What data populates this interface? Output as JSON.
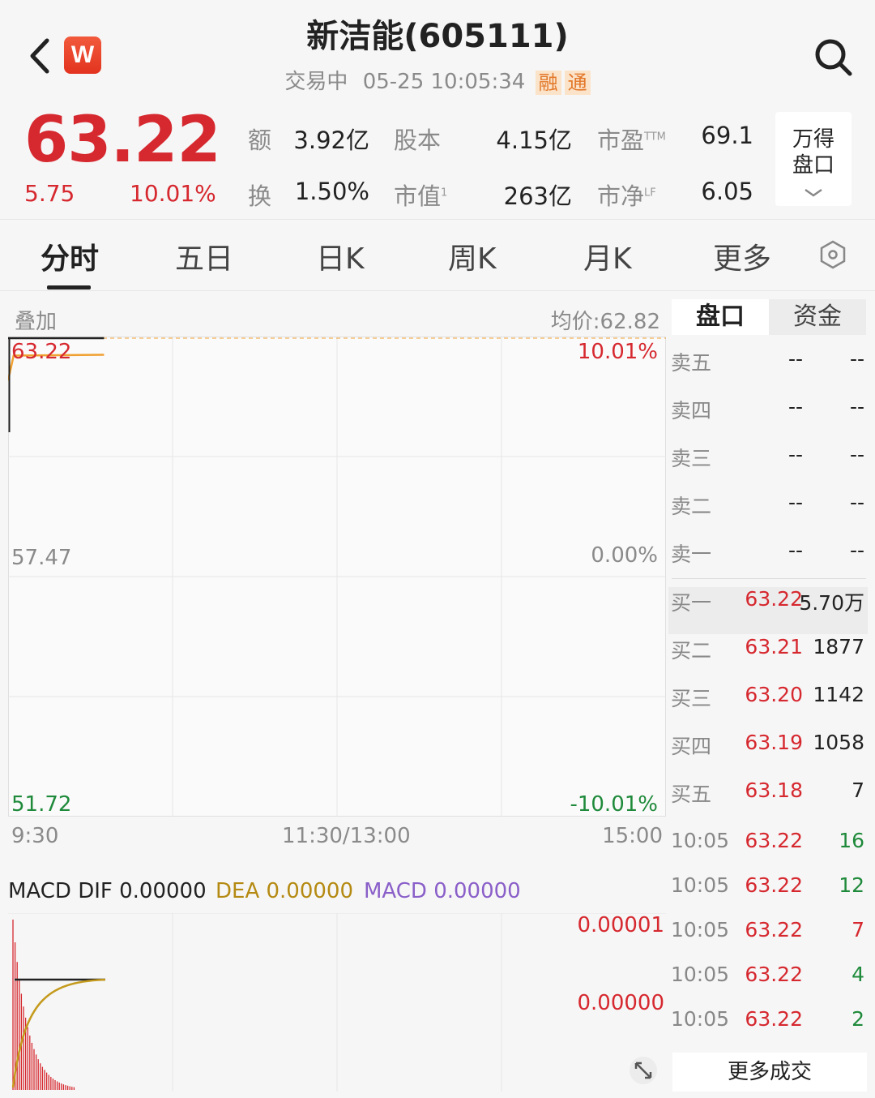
{
  "header": {
    "title": "新洁能(605111)",
    "status": "交易中",
    "datetime": "05-25 10:05:34",
    "tag_margin": "融",
    "tag_connect": "通",
    "logo_letter": "W"
  },
  "quote": {
    "price": "63.22",
    "change": "5.75",
    "change_pct": "10.01%",
    "amount_label": "额",
    "amount": "3.92亿",
    "shares_label": "股本",
    "shares": "4.15亿",
    "pe_label": "市盈",
    "pe_sup": "TTM",
    "pe": "69.1",
    "turnover_label": "换",
    "turnover": "1.50%",
    "mktcap_label": "市值",
    "mktcap_sup": "1",
    "mktcap": "263亿",
    "pb_label": "市净",
    "pb_sup": "LF",
    "pb": "6.05",
    "wind_line1": "万得",
    "wind_line2": "盘口"
  },
  "tabs": [
    "分时",
    "五日",
    "日K",
    "周K",
    "月K",
    "更多"
  ],
  "chart": {
    "overlay_label": "叠加",
    "avg_price": "均价:62.82",
    "y_top": "63.22",
    "y_mid": "57.47",
    "y_bottom": "51.72",
    "pct_top": "10.01%",
    "pct_mid": "0.00%",
    "pct_bottom": "-10.01%",
    "x_start": "9:30",
    "x_mid": "11:30/13:00",
    "x_end": "15:00",
    "macd_dif": "MACD DIF 0.00000",
    "macd_dea": "DEA 0.00000",
    "macd_macd": "MACD 0.00000",
    "macd_top": "0.00001",
    "macd_zero": "0.00000"
  },
  "chart_data": {
    "type": "line",
    "title": "",
    "xlabel": "",
    "ylabel": "",
    "x_range": [
      "9:30",
      "15:00"
    ],
    "ylim": [
      51.72,
      63.22
    ],
    "series": [
      {
        "name": "",
        "x": [
          "9:30",
          "10:05"
        ],
        "values": [
          63.22,
          63.22
        ]
      },
      {
        "name": "均价",
        "x": [
          "9:30",
          "9:32",
          "10:05"
        ],
        "values": [
          62.2,
          62.8,
          62.82
        ]
      }
    ]
  },
  "orderbook": {
    "tab_active": "盘口",
    "tab_other": "资金",
    "asks": [
      {
        "label": "卖五",
        "price": "--",
        "vol": "--"
      },
      {
        "label": "卖四",
        "price": "--",
        "vol": "--"
      },
      {
        "label": "卖三",
        "price": "--",
        "vol": "--"
      },
      {
        "label": "卖二",
        "price": "--",
        "vol": "--"
      },
      {
        "label": "卖一",
        "price": "--",
        "vol": "--"
      }
    ],
    "bids": [
      {
        "label": "买一",
        "price": "63.22",
        "vol": "5.70万"
      },
      {
        "label": "买二",
        "price": "63.21",
        "vol": "1877"
      },
      {
        "label": "买三",
        "price": "63.20",
        "vol": "1142"
      },
      {
        "label": "买四",
        "price": "63.19",
        "vol": "1058"
      },
      {
        "label": "买五",
        "price": "63.18",
        "vol": "7"
      }
    ],
    "trades": [
      {
        "time": "10:05",
        "price": "63.22",
        "vol": "16"
      },
      {
        "time": "10:05",
        "price": "63.22",
        "vol": "12"
      },
      {
        "time": "10:05",
        "price": "63.22",
        "vol": "7"
      },
      {
        "time": "10:05",
        "price": "63.22",
        "vol": "4"
      },
      {
        "time": "10:05",
        "price": "63.22",
        "vol": "2"
      }
    ],
    "more_trades": "更多成交"
  },
  "colors": {
    "up": "#d6282f",
    "down": "#1f8a3b",
    "avg_line": "#f0a030"
  }
}
